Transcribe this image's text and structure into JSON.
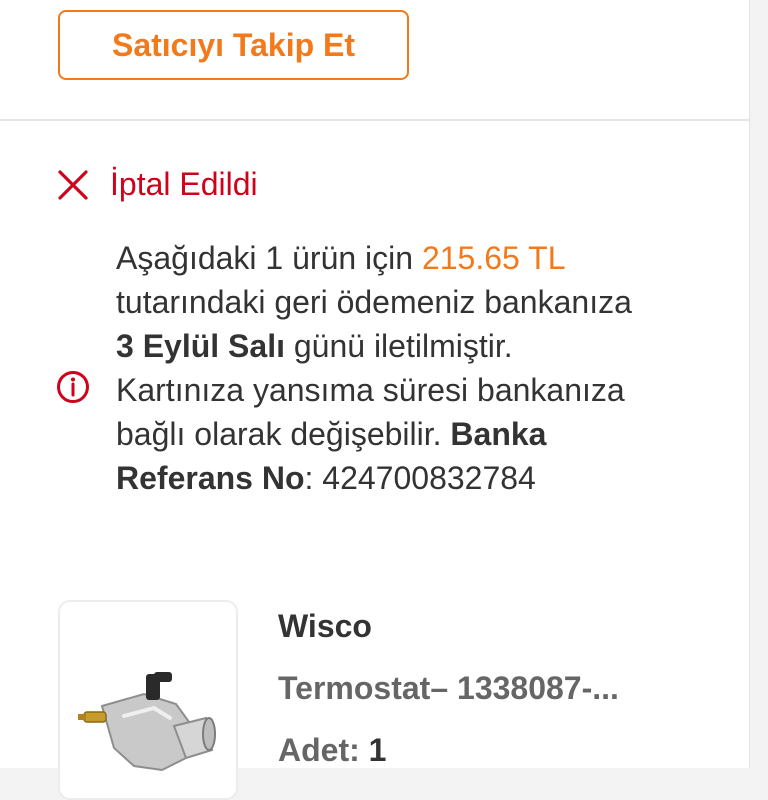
{
  "seller": {
    "follow_label": "Satıcıyı Takip Et"
  },
  "order_status": {
    "label": "İptal Edildi",
    "color": "#d0021b",
    "icon": "close-icon"
  },
  "refund_message": {
    "icon": "info-icon",
    "part1": "Aşağıdaki 1 ürün için ",
    "amount": "215.65 TL",
    "part2": " tutarındaki geri ödemeniz bankanıza ",
    "date": "3 Eylül Salı",
    "part3": " günü iletilmiştir. Kartınıza yansıma süresi bankanıza bağlı olarak değişebilir. ",
    "ref_label": "Banka Referans No",
    "part4": ": ",
    "ref_no": "424700832784"
  },
  "product": {
    "brand": "Wisco",
    "name": "Termostat– 1338087-...",
    "qty_label": "Adet: ",
    "qty_value": "1"
  },
  "colors": {
    "accent": "#f27a1a",
    "danger": "#d0021b",
    "text": "#333333"
  }
}
